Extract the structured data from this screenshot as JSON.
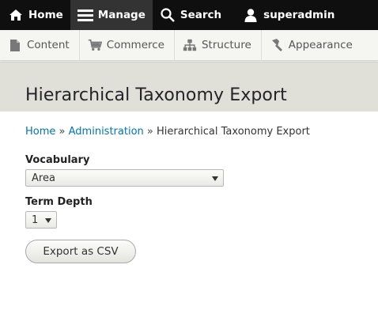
{
  "toolbar": {
    "items": [
      {
        "label": "Home",
        "icon": "home-icon"
      },
      {
        "label": "Manage",
        "icon": "hamburger-icon"
      },
      {
        "label": "Search",
        "icon": "search-icon"
      },
      {
        "label": "superadmin",
        "icon": "user-icon"
      }
    ]
  },
  "tray": {
    "items": [
      {
        "label": "Content",
        "icon": "file-icon"
      },
      {
        "label": "Commerce",
        "icon": "cart-icon"
      },
      {
        "label": "Structure",
        "icon": "sitemap-icon"
      },
      {
        "label": "Appearance",
        "icon": "paintbrush-icon"
      }
    ]
  },
  "page": {
    "title": "Hierarchical Taxonomy Export"
  },
  "breadcrumb": {
    "home": "Home",
    "separator": "»",
    "admin": "Administration",
    "current": "Hierarchical Taxonomy Export"
  },
  "form": {
    "vocabulary_label": "Vocabulary",
    "vocabulary_value": "Area",
    "depth_label": "Term Depth",
    "depth_value": "1",
    "export_button": "Export as CSV"
  },
  "colors": {
    "toolbar_bg": "#0f0f0f",
    "link": "#0074bd",
    "header_bg": "#e0e0d8"
  }
}
